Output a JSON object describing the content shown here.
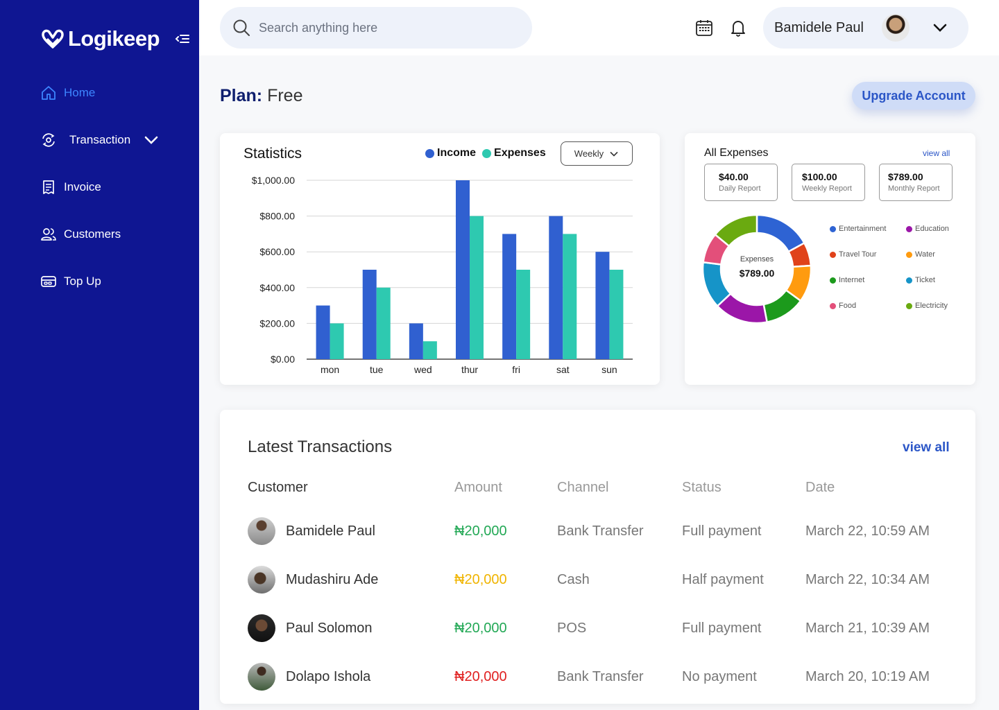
{
  "app": {
    "name": "Logikeep"
  },
  "sidebar": {
    "items": [
      {
        "label": "Home",
        "icon": "home-icon",
        "active": true
      },
      {
        "label": "Transaction",
        "icon": "transaction-icon",
        "expandable": true
      },
      {
        "label": "Invoice",
        "icon": "invoice-icon"
      },
      {
        "label": "Customers",
        "icon": "customers-icon"
      },
      {
        "label": "Top Up",
        "icon": "top-up-icon"
      }
    ]
  },
  "header": {
    "search_placeholder": "Search anything here",
    "user_name": "Bamidele Paul"
  },
  "plan": {
    "label": "Plan:",
    "value": "Free",
    "upgrade_label": "Upgrade Account"
  },
  "statistics": {
    "title": "Statistics",
    "filter": "Weekly",
    "colors": {
      "income": "#3060d0",
      "expenses": "#2ec9b0"
    }
  },
  "chart_data": {
    "type": "bar",
    "categories": [
      "mon",
      "tue",
      "wed",
      "thur",
      "fri",
      "sat",
      "sun"
    ],
    "series": [
      {
        "name": "Income",
        "values": [
          300,
          500,
          200,
          1000,
          700,
          800,
          600
        ]
      },
      {
        "name": "Expenses",
        "values": [
          200,
          400,
          100,
          800,
          500,
          700,
          500
        ]
      }
    ],
    "ylim": [
      0,
      1000
    ],
    "yticks": [
      "$0.00",
      "$200.00",
      "$400.00",
      "$600.00",
      "$800.00",
      "$1,000.00"
    ],
    "legend": "top",
    "grid": true
  },
  "expenses": {
    "title": "All Expenses",
    "view_all": "view all",
    "reports": [
      {
        "amount": "$40.00",
        "label": "Daily Report"
      },
      {
        "amount": "$100.00",
        "label": "Weekly Report"
      },
      {
        "amount": "$789.00",
        "label": "Monthly Report"
      }
    ],
    "donut_label": "Expenses",
    "donut_total": "$789.00",
    "categories": [
      {
        "name": "Entertainment",
        "color": "#2e63d3",
        "share": 0.17
      },
      {
        "name": "Travel Tour",
        "color": "#e0421a",
        "share": 0.07
      },
      {
        "name": "Water",
        "color": "#ff9b0f",
        "share": 0.11
      },
      {
        "name": "Electricity",
        "color": "#1c9a1c",
        "share": 0.12
      },
      {
        "name": "Education",
        "color": "#9b16a8",
        "share": 0.16
      },
      {
        "name": "Ticket",
        "color": "#1694c8",
        "share": 0.14
      },
      {
        "name": "Food",
        "color": "#e34f7a",
        "share": 0.09
      },
      {
        "name": "Internet",
        "color": "#6aaa10",
        "share": 0.14
      }
    ],
    "legend_items": [
      {
        "name": "Entertainment",
        "color": "#2e63d3"
      },
      {
        "name": "Education",
        "color": "#9b16a8"
      },
      {
        "name": "Travel Tour",
        "color": "#e0421a"
      },
      {
        "name": "Water",
        "color": "#ff9b0f"
      },
      {
        "name": "Internet",
        "color": "#1c9a1c"
      },
      {
        "name": "Ticket",
        "color": "#1694c8"
      },
      {
        "name": "Food",
        "color": "#e34f7a"
      },
      {
        "name": "Electricity",
        "color": "#6aaa10"
      }
    ]
  },
  "transactions": {
    "title": "Latest Transactions",
    "view_all": "view all",
    "columns": [
      "Customer",
      "Amount",
      "Channel",
      "Status",
      "Date"
    ],
    "rows": [
      {
        "customer": "Bamidele Paul",
        "amount": "₦20,000",
        "amount_color": "#22a855",
        "channel": "Bank Transfer",
        "status": "Full payment",
        "date": "March 22, 10:59 AM"
      },
      {
        "customer": "Mudashiru Ade",
        "amount": "₦20,000",
        "amount_color": "#f0b400",
        "channel": "Cash",
        "status": "Half payment",
        "date": "March 22, 10:34 AM"
      },
      {
        "customer": "Paul Solomon",
        "amount": "₦20,000",
        "amount_color": "#22a855",
        "channel": "POS",
        "status": "Full payment",
        "date": "March 21, 10:39 AM"
      },
      {
        "customer": "Dolapo Ishola",
        "amount": "₦20,000",
        "amount_color": "#e02020",
        "channel": "Bank Transfer",
        "status": "No payment",
        "date": "March 20, 10:19 AM"
      }
    ]
  }
}
